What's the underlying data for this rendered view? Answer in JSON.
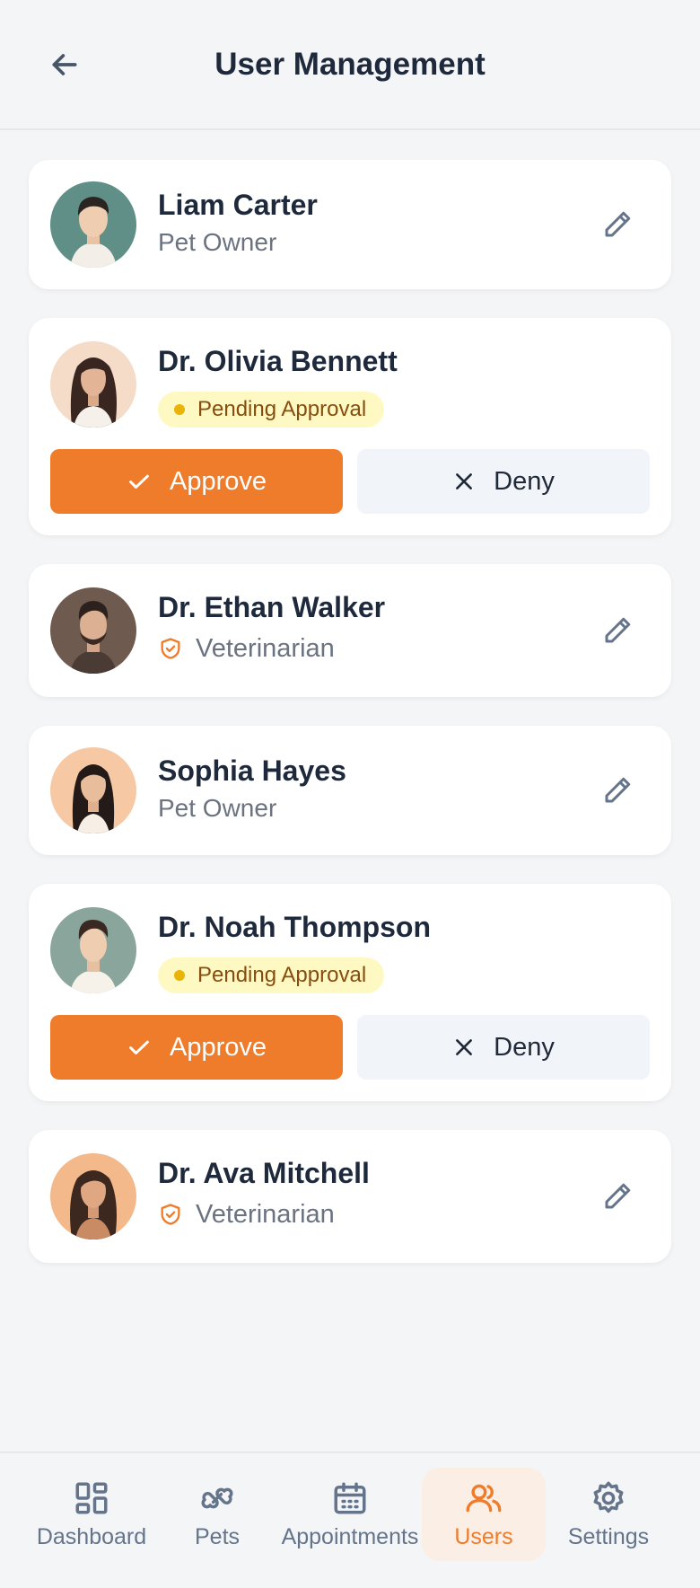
{
  "header": {
    "title": "User Management"
  },
  "actions": {
    "approve_label": "Approve",
    "deny_label": "Deny"
  },
  "users": [
    {
      "name": "Liam Carter",
      "status": "Pet Owner",
      "type": "owner"
    },
    {
      "name": "Dr. Olivia Bennett",
      "status": "Pending Approval",
      "type": "pending"
    },
    {
      "name": "Dr. Ethan Walker",
      "status": "Veterinarian",
      "type": "vet"
    },
    {
      "name": "Sophia Hayes",
      "status": "Pet Owner",
      "type": "owner"
    },
    {
      "name": "Dr. Noah Thompson",
      "status": "Pending Approval",
      "type": "pending"
    },
    {
      "name": "Dr. Ava Mitchell",
      "status": "Veterinarian",
      "type": "vet"
    }
  ],
  "nav": {
    "items": [
      {
        "label": "Dashboard",
        "icon": "dashboard-icon"
      },
      {
        "label": "Pets",
        "icon": "bone-icon"
      },
      {
        "label": "Appointments",
        "icon": "calendar-icon"
      },
      {
        "label": "Users",
        "icon": "users-icon",
        "active": true
      },
      {
        "label": "Settings",
        "icon": "gear-icon"
      }
    ]
  },
  "colors": {
    "accent": "#ee7c2b",
    "badge_bg": "#fef9c3",
    "badge_dot": "#eab308",
    "deny_bg": "#f1f4f8",
    "page_bg": "#f4f5f6"
  }
}
